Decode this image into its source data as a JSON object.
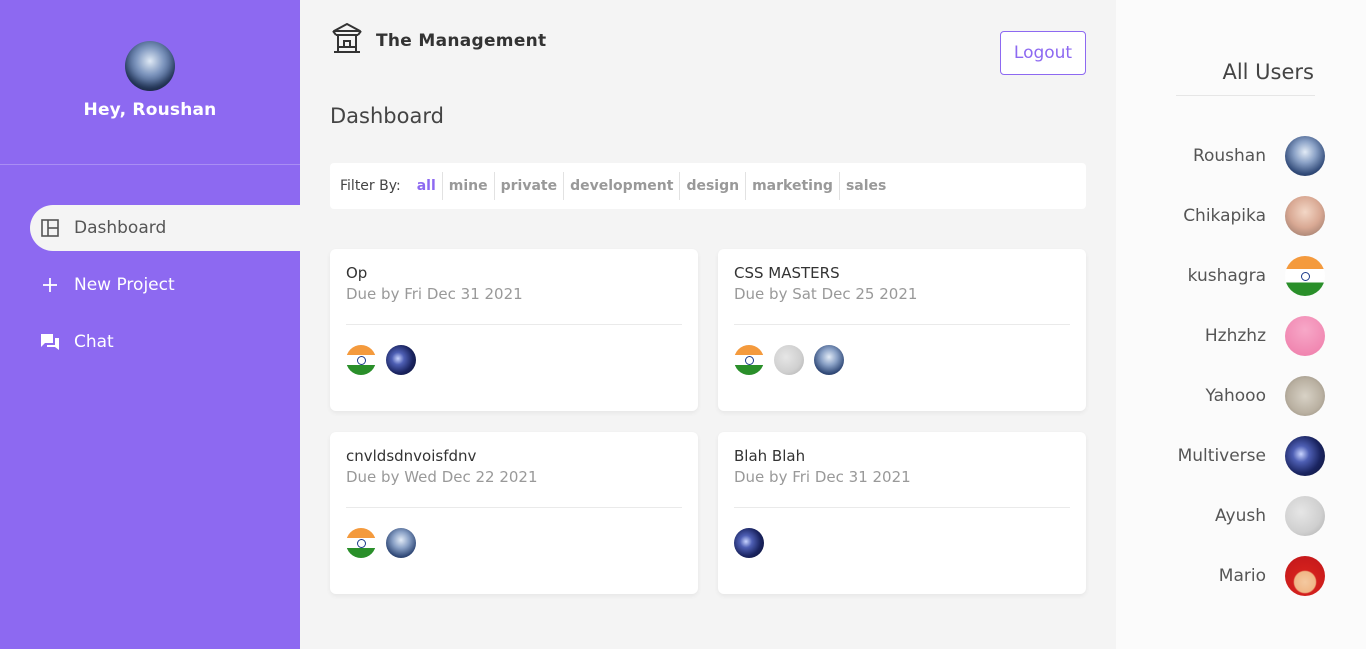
{
  "sidebar": {
    "greeting": "Hey, Roushan",
    "nav": [
      {
        "label": "Dashboard",
        "icon": "dashboard-icon",
        "active": true
      },
      {
        "label": "New Project",
        "icon": "plus-icon",
        "active": false
      },
      {
        "label": "Chat",
        "icon": "chat-icon",
        "active": false
      }
    ]
  },
  "header": {
    "brand": "The Management",
    "logout_label": "Logout"
  },
  "main": {
    "title": "Dashboard",
    "filter_label": "Filter By:",
    "filters": [
      "all",
      "mine",
      "private",
      "development",
      "design",
      "marketing",
      "sales"
    ],
    "active_filter": "all"
  },
  "projects": [
    {
      "name": "Op",
      "due": "Due by Fri Dec 31 2021",
      "avatars": [
        "india",
        "storm"
      ]
    },
    {
      "name": "CSS MASTERS",
      "due": "Due by Sat Dec 25 2021",
      "avatars": [
        "india",
        "grey",
        "hood"
      ]
    },
    {
      "name": "cnvldsdnvoisfdnv",
      "due": "Due by Wed Dec 22 2021",
      "avatars": [
        "india",
        "hood"
      ]
    },
    {
      "name": "Blah Blah",
      "due": "Due by Fri Dec 31 2021",
      "avatars": [
        "storm"
      ]
    }
  ],
  "users_panel": {
    "title": "All Users",
    "users": [
      {
        "name": "Roushan",
        "avatar": "hood"
      },
      {
        "name": "Chikapika",
        "avatar": "baby"
      },
      {
        "name": "kushagra",
        "avatar": "india"
      },
      {
        "name": "Hzhzhz",
        "avatar": "pink"
      },
      {
        "name": "Yahooo",
        "avatar": "stone"
      },
      {
        "name": "Multiverse",
        "avatar": "storm"
      },
      {
        "name": "Ayush",
        "avatar": "grey"
      },
      {
        "name": "Mario",
        "avatar": "mario"
      }
    ]
  },
  "colors": {
    "accent": "#8d69f1",
    "background": "#f4f4f4",
    "muted_text": "#999999"
  }
}
